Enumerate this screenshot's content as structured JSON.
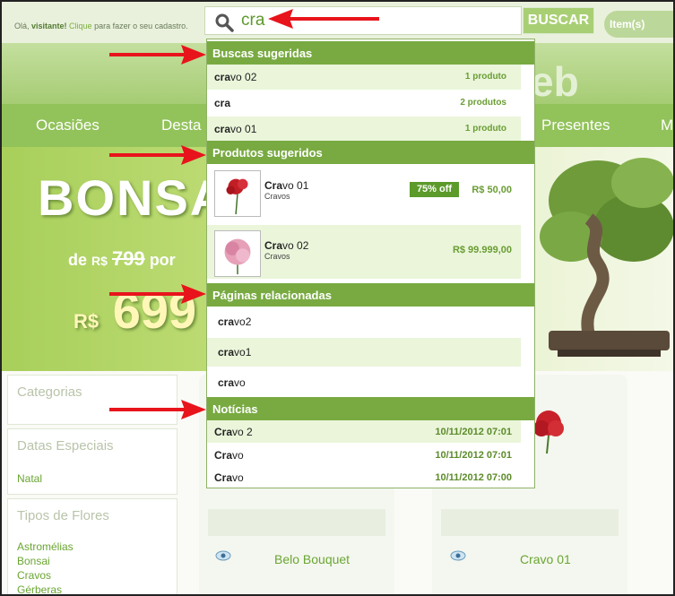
{
  "topbar": {
    "welcome_prefix": "Olá, ",
    "welcome_name": "visitante!",
    "welcome_link": "Clique",
    "welcome_suffix": " para fazer o seu cadastro.",
    "items_label": "Item(s)"
  },
  "search": {
    "query": "cra",
    "button_label": "BUSCAR"
  },
  "header": {
    "logo_fragment": "eb"
  },
  "nav": {
    "items": [
      "Ocasiões",
      "Desta",
      "Presentes",
      "M"
    ]
  },
  "banner": {
    "title": "BONSA",
    "de_prefix": "de",
    "currency": "R$",
    "old_price": "799",
    "por": "por",
    "new_price": "699"
  },
  "sidebar": {
    "categorias_title": "Categorias",
    "datas_title": "Datas Especiais",
    "datas_items": [
      "Natal"
    ],
    "tipos_title": "Tipos de Flores",
    "tipos_items": [
      "Astromélias",
      "Bonsai",
      "Cravos",
      "Gérberas"
    ]
  },
  "cards": [
    {
      "name": "Belo Bouquet"
    },
    {
      "name": "Cravo 01"
    }
  ],
  "dropdown": {
    "sections": {
      "buscas": "Buscas sugeridas",
      "produtos": "Produtos sugeridos",
      "paginas": "Páginas relacionadas",
      "noticias": "Notícias"
    },
    "buscas": [
      {
        "match": "cra",
        "rest": "vo 02",
        "count": "1 produto"
      },
      {
        "match": "cra",
        "rest": "",
        "count": "2 produtos"
      },
      {
        "match": "cra",
        "rest": "vo 01",
        "count": "1 produto"
      }
    ],
    "produtos": [
      {
        "match": "Cra",
        "rest": "vo 01",
        "category": "Cravos",
        "discount": "75% off",
        "price": "R$ 50,00"
      },
      {
        "match": "Cra",
        "rest": "vo 02",
        "category": "Cravos",
        "discount": "",
        "price": "R$ 99.999,00"
      }
    ],
    "paginas": [
      {
        "match": "cra",
        "rest": "vo2"
      },
      {
        "match": "cra",
        "rest": "vo1"
      },
      {
        "match": "cra",
        "rest": "vo"
      }
    ],
    "noticias": [
      {
        "match": "Cra",
        "rest": "vo 2",
        "date": "10/11/2012 07:01"
      },
      {
        "match": "Cra",
        "rest": "vo",
        "date": "10/11/2012 07:01"
      },
      {
        "match": "Cra",
        "rest": "vo",
        "date": "10/11/2012 07:00"
      }
    ]
  },
  "colors": {
    "accent_green": "#78aa41",
    "row_highlight": "#eaf5da",
    "arrow_red": "#e8141c"
  },
  "icons": {
    "search": "magnifier-icon",
    "arrow": "red-arrow-icon",
    "eye": "eye-icon"
  }
}
